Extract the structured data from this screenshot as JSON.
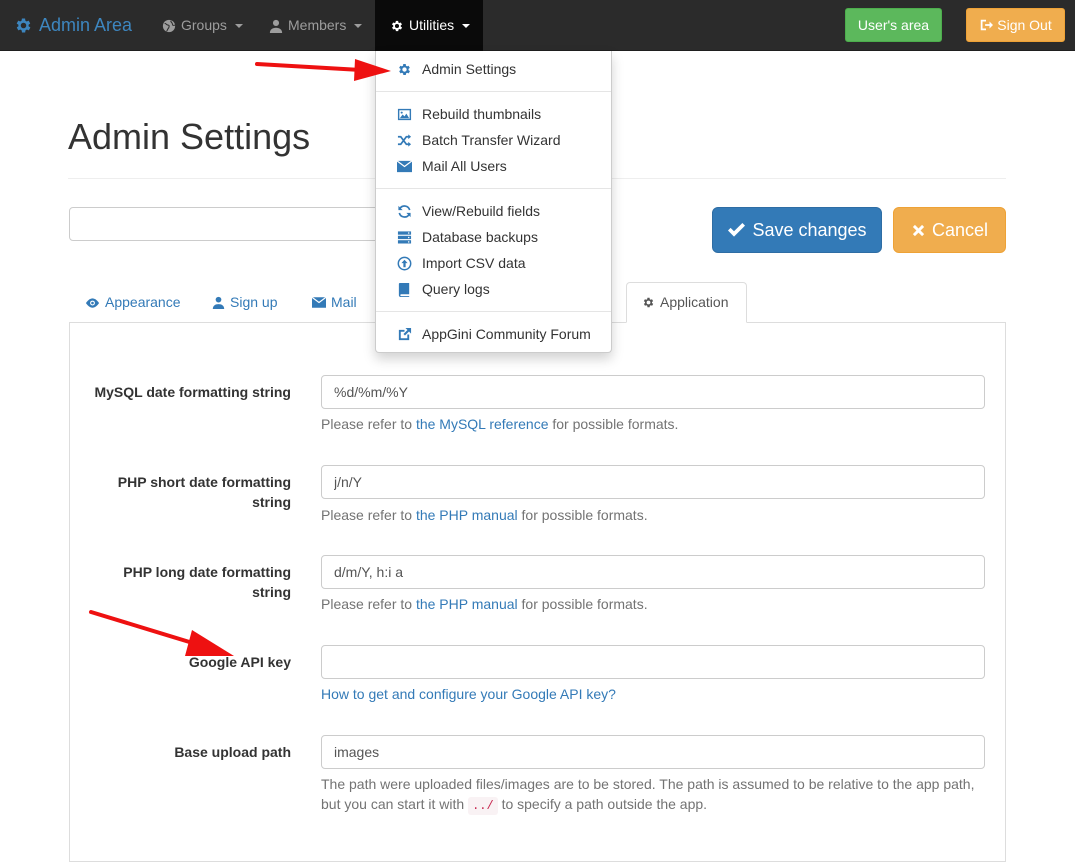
{
  "navbar": {
    "brand": "Admin Area",
    "groups": "Groups",
    "members": "Members",
    "utilities": "Utilities",
    "users_area": "User's area",
    "sign_out": "Sign Out"
  },
  "dropdown": {
    "items": [
      {
        "label": "Admin Settings",
        "icon": "gear-icon"
      },
      {
        "label": "Rebuild thumbnails",
        "icon": "picture-icon"
      },
      {
        "label": "Batch Transfer Wizard",
        "icon": "random-icon"
      },
      {
        "label": "Mail All Users",
        "icon": "envelope-icon"
      },
      {
        "label": "View/Rebuild fields",
        "icon": "refresh-icon"
      },
      {
        "label": "Database backups",
        "icon": "database-icon"
      },
      {
        "label": "Import CSV data",
        "icon": "upload-icon"
      },
      {
        "label": "Query logs",
        "icon": "book-icon"
      },
      {
        "label": "AppGini Community Forum",
        "icon": "external-link-icon"
      }
    ]
  },
  "page": {
    "title": "Admin Settings",
    "save_label": "Save changes",
    "cancel_label": "Cancel"
  },
  "tabs": [
    {
      "label": "Appearance",
      "icon": "eye-icon"
    },
    {
      "label": "Sign up",
      "icon": "user-icon"
    },
    {
      "label": "Mail",
      "icon": "envelope-icon"
    },
    {
      "label": "Application",
      "icon": "gear-icon",
      "active": true
    }
  ],
  "form": {
    "mysql_date": {
      "label": "MySQL date formatting string",
      "value": "%d/%m/%Y",
      "help_pre": "Please refer to ",
      "help_link": "the MySQL reference",
      "help_post": " for possible formats."
    },
    "php_short": {
      "label": "PHP short date formatting string",
      "value": "j/n/Y",
      "help_pre": "Please refer to ",
      "help_link": "the PHP manual",
      "help_post": " for possible formats."
    },
    "php_long": {
      "label": "PHP long date formatting string",
      "value": "d/m/Y, h:i a",
      "help_pre": "Please refer to ",
      "help_link": "the PHP manual",
      "help_post": " for possible formats."
    },
    "google_api": {
      "label": "Google API key",
      "value": "",
      "help_link": "How to get and configure your Google API key?"
    },
    "upload_path": {
      "label": "Base upload path",
      "value": "images",
      "help_pre": "The path were uploaded files/images are to be stored. The path is assumed to be relative to the app path, but you can start it with ",
      "help_code": "../",
      "help_post": " to specify a path outside the app."
    }
  },
  "colors": {
    "navbar_bg": "#2b2b2b",
    "brand": "#3d86bf",
    "primary": "#337ab7",
    "success": "#5cb85c",
    "warning": "#f0ad4e",
    "annotation_arrow": "#ee1111"
  }
}
